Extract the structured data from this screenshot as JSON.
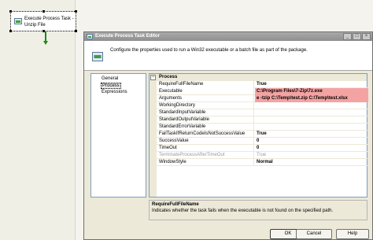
{
  "designer": {
    "task_label_line1": "Execute Process Task -",
    "task_label_line2": "Unzip File"
  },
  "dialog": {
    "title": "Execute Process Task Editor",
    "header_text": "Configure the properties used to run a Win32 executable or a batch file as part of the package.",
    "nav_items": [
      {
        "label": "General"
      },
      {
        "label": "Process"
      },
      {
        "label": "Expressions"
      }
    ],
    "category": "Process",
    "properties": [
      {
        "name": "RequireFullFileName",
        "value": "True"
      },
      {
        "name": "Executable",
        "value": "C:\\Program Files\\7-Zip\\7z.exe"
      },
      {
        "name": "Arguments",
        "value": "e -tzip C:\\Temp\\test.zip C:\\Temp\\test.xlsx"
      },
      {
        "name": "WorkingDirectory",
        "value": ""
      },
      {
        "name": "StandardInputVariable",
        "value": ""
      },
      {
        "name": "StandardOutputVariable",
        "value": ""
      },
      {
        "name": "StandardErrorVariable",
        "value": ""
      },
      {
        "name": "FailTaskIfReturnCodeIsNotSuccessValue",
        "value": "True"
      },
      {
        "name": "SuccessValue",
        "value": "0"
      },
      {
        "name": "TimeOut",
        "value": "0"
      },
      {
        "name": "TerminateProcessAfterTimeOut",
        "value": "True"
      },
      {
        "name": "WindowStyle",
        "value": "Normal"
      }
    ],
    "description_title": "RequireFullFileName",
    "description_text": "Indicates whether the task fails when the executable is not found on the specified path.",
    "buttons": {
      "ok": "OK",
      "cancel": "Cancel",
      "help": "Help"
    },
    "colors": {
      "highlight": "#f4a3a3",
      "titlebar": "#999999"
    }
  }
}
